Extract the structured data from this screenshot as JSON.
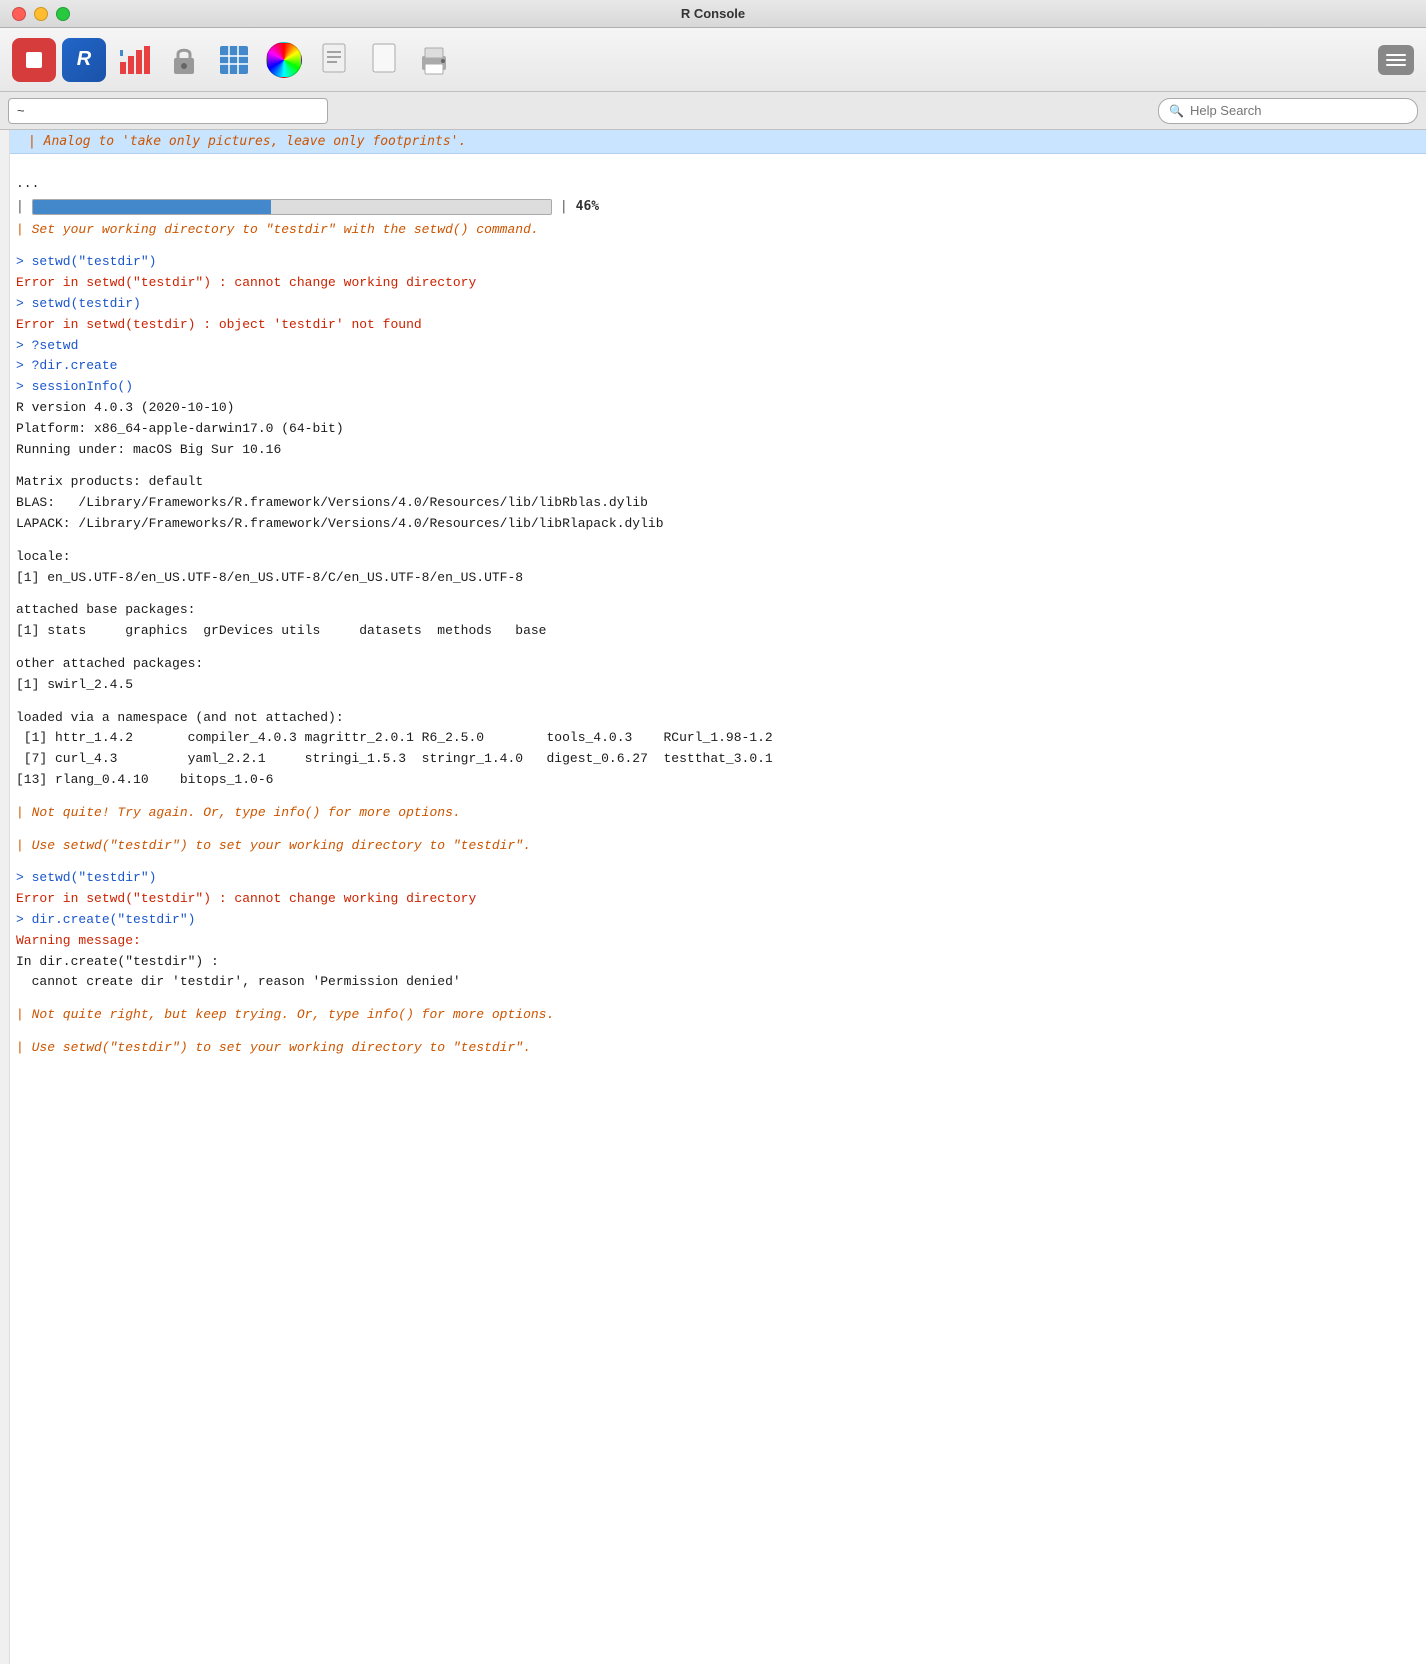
{
  "window": {
    "title": "R Console"
  },
  "toolbar": {
    "stop_label": "STOP",
    "r_label": "R",
    "buttons": [
      "stop",
      "r",
      "chart",
      "lock",
      "spreadsheet",
      "colorwheel",
      "script",
      "blank",
      "printer"
    ]
  },
  "input_row": {
    "tilde_value": "~",
    "search_placeholder": "Help Search"
  },
  "console": {
    "progress_label": "|============================================",
    "progress_pct": "46%",
    "lines": [
      {
        "type": "swirl_msg",
        "text": "| Analog to 'take only pictures, leave only footprints'."
      },
      {
        "type": "blank"
      },
      {
        "type": "text",
        "text": "..."
      },
      {
        "type": "text",
        "text": "  |============================================                   |  46%"
      },
      {
        "type": "swirl_msg",
        "text": "| Set your working directory to \"testdir\" with the setwd() command."
      },
      {
        "type": "blank"
      },
      {
        "type": "prompt",
        "text": "> setwd(\"testdir\")"
      },
      {
        "type": "error",
        "text": "Error in setwd(\"testdir\") : cannot change working directory"
      },
      {
        "type": "prompt",
        "text": "> setwd(testdir)"
      },
      {
        "type": "error",
        "text": "Error in setwd(testdir) : object 'testdir' not found"
      },
      {
        "type": "prompt",
        "text": "> ?setwd"
      },
      {
        "type": "prompt",
        "text": "> ?dir.create"
      },
      {
        "type": "prompt",
        "text": "> sessionInfo()"
      },
      {
        "type": "text",
        "text": "R version 4.0.3 (2020-10-10)"
      },
      {
        "type": "text",
        "text": "Platform: x86_64-apple-darwin17.0 (64-bit)"
      },
      {
        "type": "text",
        "text": "Running under: macOS Big Sur 10.16"
      },
      {
        "type": "blank"
      },
      {
        "type": "text",
        "text": "Matrix products: default"
      },
      {
        "type": "text",
        "text": "BLAS:   /Library/Frameworks/R.framework/Versions/4.0/Resources/lib/libRblas.dylib"
      },
      {
        "type": "text",
        "text": "LAPACK: /Library/Frameworks/R.framework/Versions/4.0/Resources/lib/libRlapack.dylib"
      },
      {
        "type": "blank"
      },
      {
        "type": "text",
        "text": "locale:"
      },
      {
        "type": "text",
        "text": "[1] en_US.UTF-8/en_US.UTF-8/en_US.UTF-8/C/en_US.UTF-8/en_US.UTF-8"
      },
      {
        "type": "blank"
      },
      {
        "type": "text",
        "text": "attached base packages:"
      },
      {
        "type": "text",
        "text": "[1] stats     graphics  grDevices utils     datasets  methods   base"
      },
      {
        "type": "blank"
      },
      {
        "type": "text",
        "text": "other attached packages:"
      },
      {
        "type": "text",
        "text": "[1] swirl_2.4.5"
      },
      {
        "type": "blank"
      },
      {
        "type": "text",
        "text": "loaded via a namespace (and not attached):"
      },
      {
        "type": "text",
        "text": " [1] httr_1.4.2       compiler_4.0.3 magrittr_2.0.1 R6_2.5.0        tools_4.0.3    RCurl_1.98-1.2"
      },
      {
        "type": "text",
        "text": " [7] curl_4.3         yaml_2.2.1     stringi_1.5.3  stringr_1.4.0   digest_0.6.27  testthat_3.0.1"
      },
      {
        "type": "text",
        "text": "[13] rlang_0.4.10    bitops_1.0-6"
      },
      {
        "type": "blank"
      },
      {
        "type": "swirl_msg",
        "text": "| Not quite! Try again. Or, type info() for more options."
      },
      {
        "type": "blank"
      },
      {
        "type": "swirl_msg",
        "text": "| Use setwd(\"testdir\") to set your working directory to \"testdir\"."
      },
      {
        "type": "blank"
      },
      {
        "type": "prompt",
        "text": "> setwd(\"testdir\")"
      },
      {
        "type": "error",
        "text": "Error in setwd(\"testdir\") : cannot change working directory"
      },
      {
        "type": "prompt",
        "text": "> dir.create(\"testdir\")"
      },
      {
        "type": "warning",
        "text": "Warning message:"
      },
      {
        "type": "text",
        "text": "In dir.create(\"testdir\") :"
      },
      {
        "type": "text",
        "text": "  cannot create dir 'testdir', reason 'Permission denied'"
      },
      {
        "type": "blank"
      },
      {
        "type": "swirl_msg",
        "text": "| Not quite right, but keep trying. Or, type info() for more options."
      },
      {
        "type": "blank"
      },
      {
        "type": "swirl_msg",
        "text": "| Use setwd(\"testdir\") to set your working directory to \"testdir\"."
      }
    ]
  }
}
